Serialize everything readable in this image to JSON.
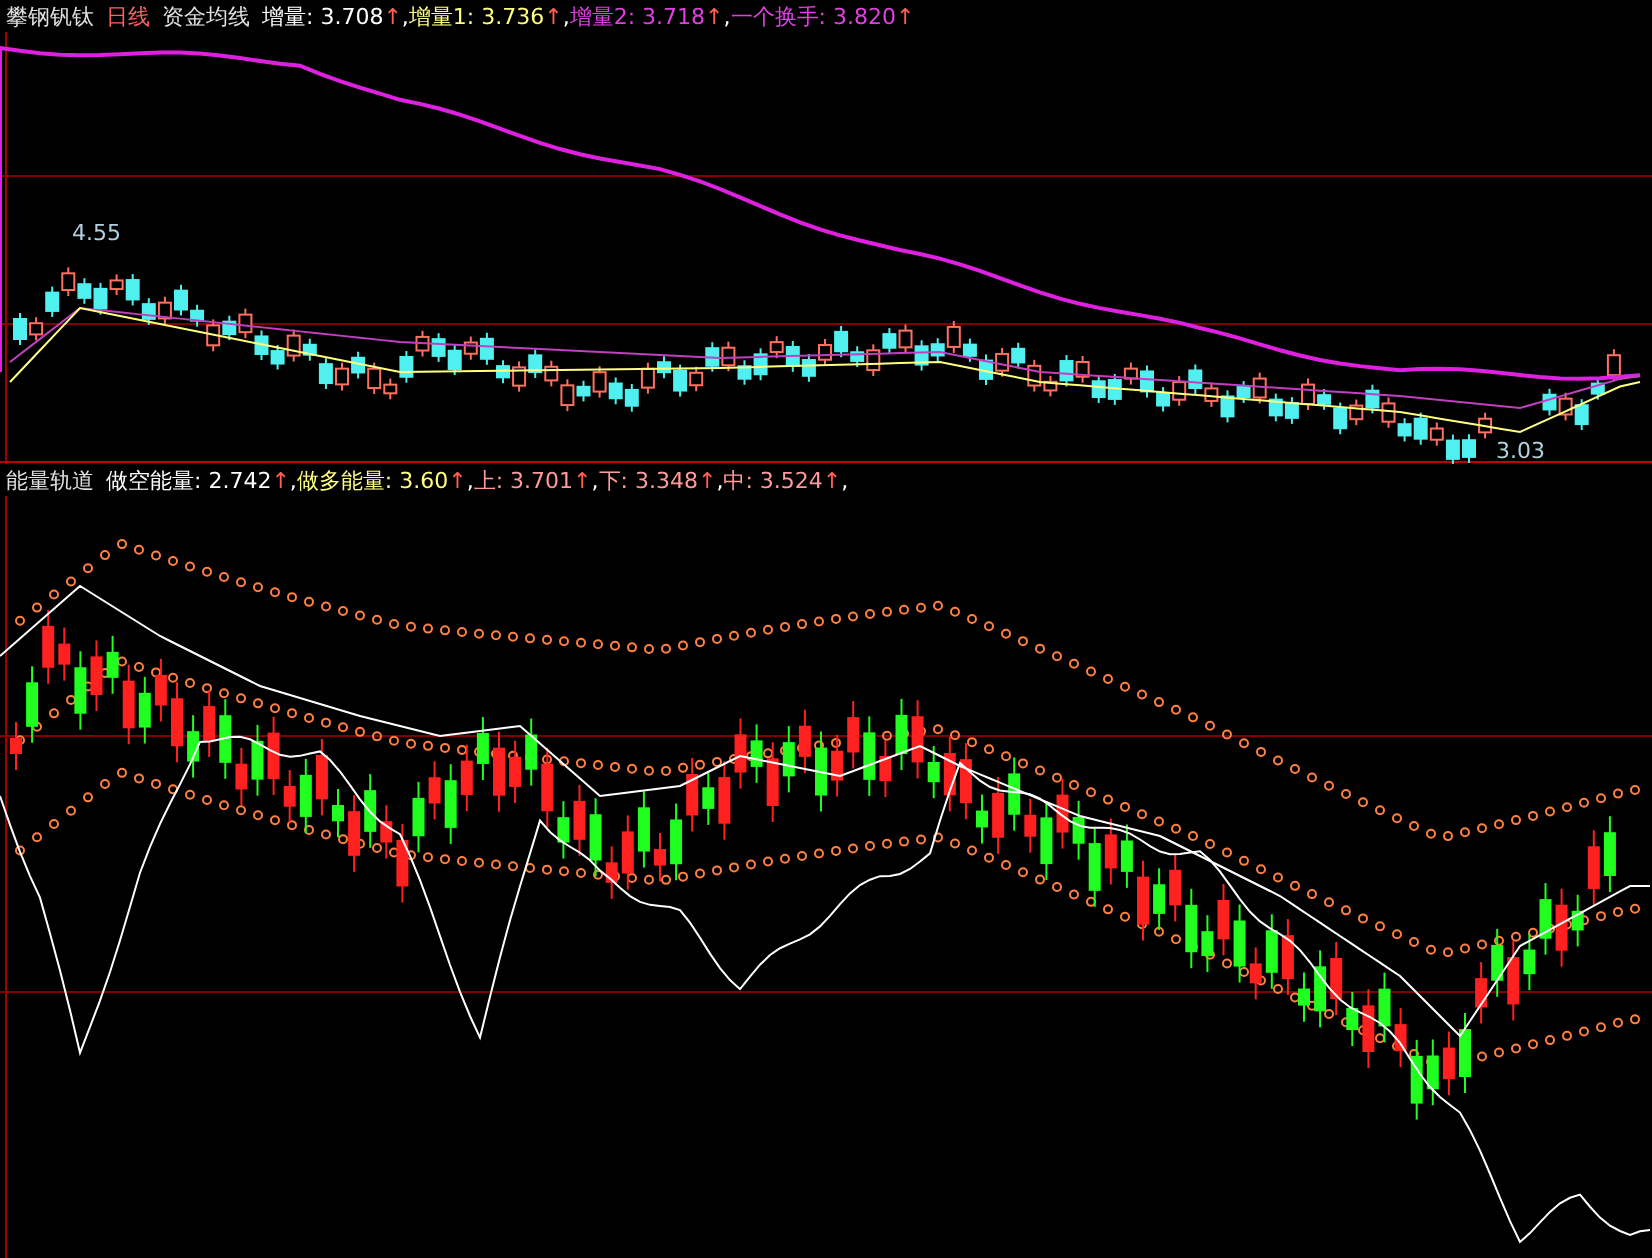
{
  "panels": [
    {
      "title": "攀钢钒钛",
      "period": "日线",
      "indicator": "资金均线",
      "legend": [
        {
          "label": "增量: 3.708",
          "arrow": "↑",
          "sep": ",",
          "color": "#ffffff"
        },
        {
          "label": "增量1: 3.736",
          "arrow": "↑",
          "sep": ",",
          "color": "#ffff80"
        },
        {
          "label": "增量2: 3.718",
          "arrow": "↑",
          "sep": ",",
          "color": "#e040e0"
        },
        {
          "label": "一个换手: 3.820",
          "arrow": "↑",
          "color": "#e040e0"
        }
      ],
      "high_label": "4.55",
      "low_label": "3.03"
    },
    {
      "title": "能量轨道",
      "legend": [
        {
          "label": "做空能量: 2.742",
          "arrow": "↑",
          "sep": ",",
          "color": "#ffffff"
        },
        {
          "label": "做多能量: 3.60",
          "arrow": "↑",
          "sep": ",",
          "color": "#ffff80"
        },
        {
          "label": "上: 3.701",
          "arrow": "↑",
          "sep": ",",
          "color": "#ff9a9a"
        },
        {
          "label": "下: 3.348",
          "arrow": "↑",
          "sep": ",",
          "color": "#ff9a9a"
        },
        {
          "label": "中: 3.524",
          "arrow": "↑",
          "sep": ",",
          "color": "#ff9a9a"
        }
      ]
    }
  ]
}
